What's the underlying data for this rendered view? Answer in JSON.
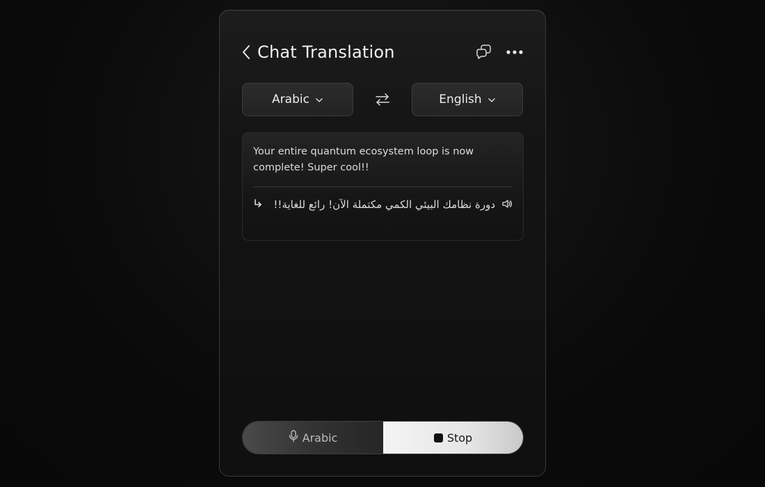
{
  "header": {
    "title": "Chat Translation"
  },
  "languages": {
    "source": "Arabic",
    "target": "English"
  },
  "message": {
    "source_text": "Your entire quantum ecosystem loop is now complete! Super cool!!",
    "translated_text": "دورة نظامك البيئي الكمي مكتملة الآن! رائع للغاية!!"
  },
  "bottom_bar": {
    "mic_label": "Arabic",
    "stop_label": "Stop"
  },
  "icons": {
    "back": "chevron-left-icon",
    "chat": "chat-bubbles-icon",
    "more": "more-horizontal-icon",
    "swap": "swap-arrows-icon",
    "dropdown": "chevron-down-icon",
    "reply": "reply-arrow-icon",
    "speaker": "speaker-icon",
    "mic": "microphone-icon",
    "stop": "stop-icon"
  },
  "colors": {
    "background": "#0a0a0a",
    "panel": "#141414",
    "stop_button": "#ececec",
    "text": "#e8e8e8"
  }
}
